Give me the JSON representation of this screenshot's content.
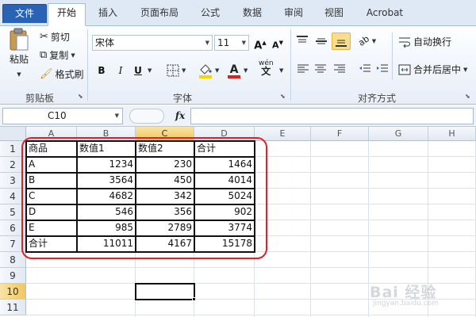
{
  "tabs": [
    "文件",
    "开始",
    "插入",
    "页面布局",
    "公式",
    "数据",
    "审阅",
    "视图",
    "Acrobat"
  ],
  "clipboard": {
    "paste": "粘贴",
    "cut": "剪切",
    "copy": "复制",
    "format_painter": "格式刷",
    "group": "剪贴板"
  },
  "font": {
    "name": "宋体",
    "size": "11",
    "bold": "B",
    "italic": "I",
    "underline": "U",
    "grow": "A",
    "shrink": "A",
    "phonetic": "wén",
    "group": "字体"
  },
  "alignment": {
    "wrap": "自动换行",
    "merge": "合并后居中",
    "group": "对齐方式"
  },
  "formula_bar": {
    "name_box": "C10",
    "fx": "fx",
    "value": ""
  },
  "grid": {
    "columns": [
      "A",
      "B",
      "C",
      "D",
      "E",
      "F",
      "G",
      "H"
    ],
    "rows": [
      "1",
      "2",
      "3",
      "4",
      "5",
      "6",
      "7",
      "8",
      "9",
      "10",
      "11"
    ],
    "selected_column": "C",
    "selected_row": "10",
    "table": [
      [
        "商品",
        "数值1",
        "数值2",
        "合计"
      ],
      [
        "A",
        "1234",
        "230",
        "1464"
      ],
      [
        "B",
        "3564",
        "450",
        "4014"
      ],
      [
        "C",
        "4682",
        "342",
        "5024"
      ],
      [
        "D",
        "546",
        "356",
        "902"
      ],
      [
        "E",
        "985",
        "2789",
        "3774"
      ],
      [
        "合计",
        "11011",
        "4167",
        "15178"
      ]
    ]
  },
  "colors": {
    "file_tab": "#2a62b6",
    "highlight_oval": "#e0202a",
    "selected_header": "#f1c75c",
    "fill_icon": "#f5d600",
    "font_color_icon": "#e02020"
  },
  "watermark": "Bai 经验",
  "watermark_sub": "jingyan.baidu.com"
}
